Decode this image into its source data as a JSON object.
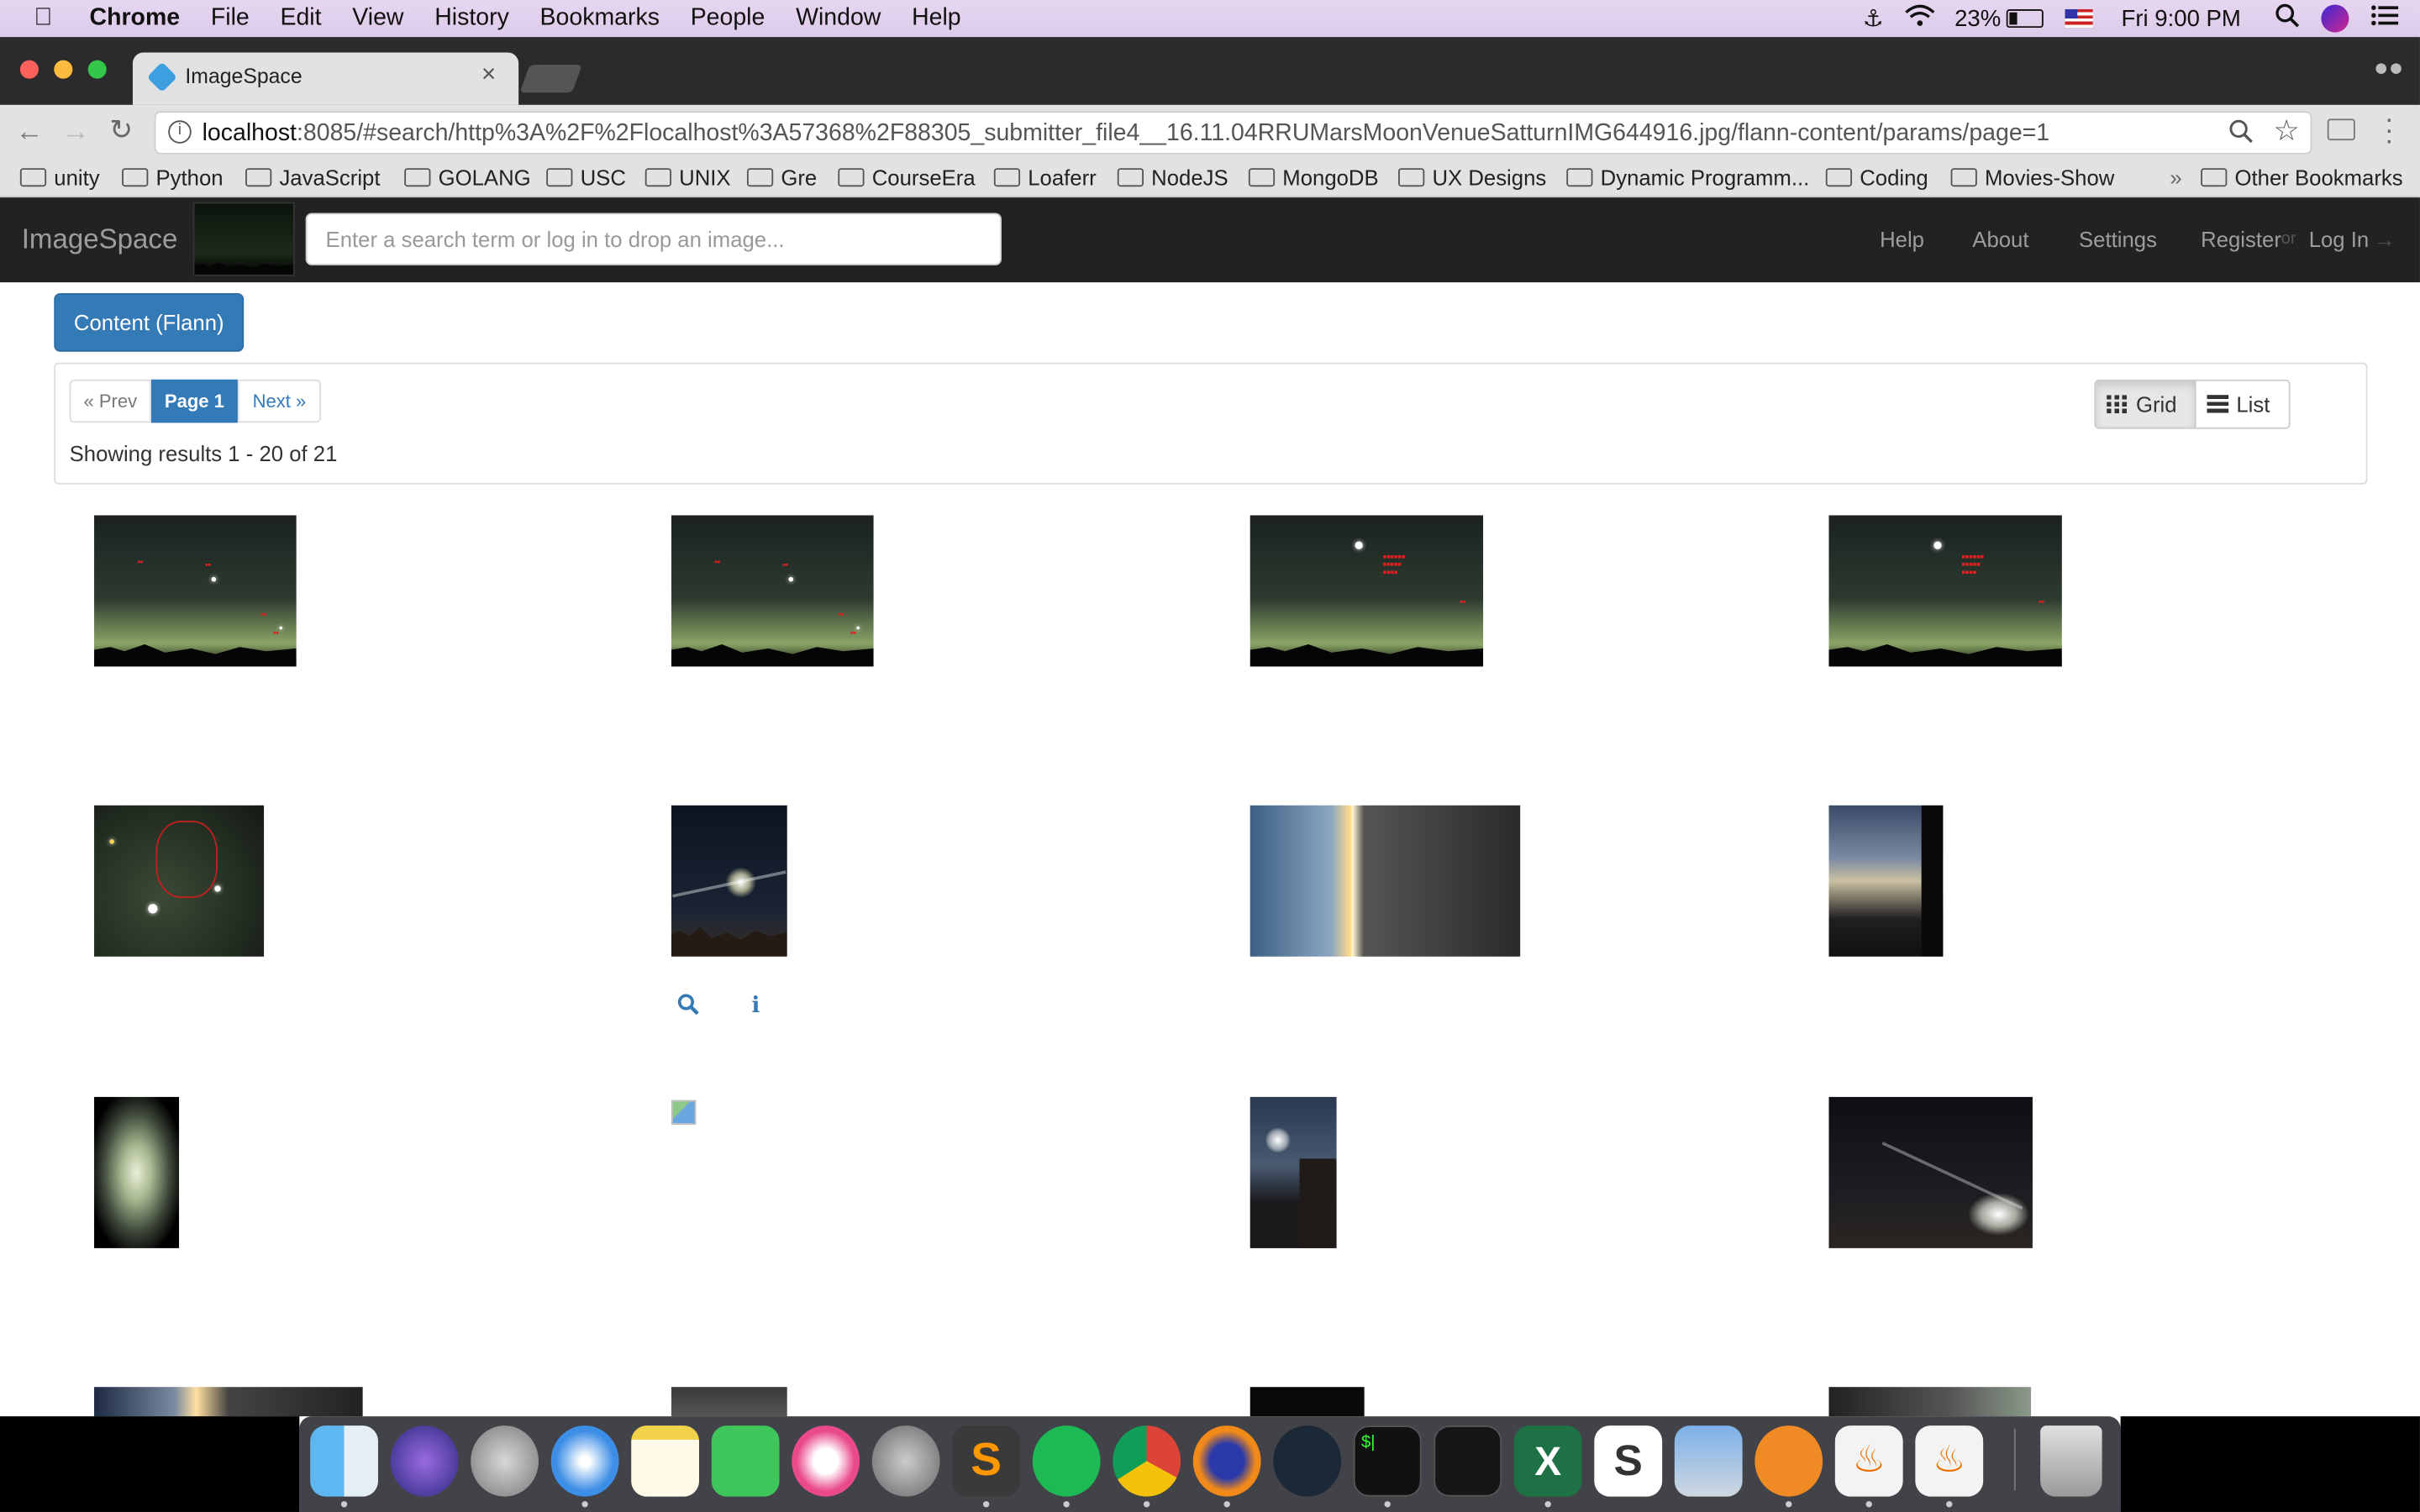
{
  "menubar": {
    "app": "Chrome",
    "items": [
      "File",
      "Edit",
      "View",
      "History",
      "Bookmarks",
      "People",
      "Window",
      "Help"
    ],
    "battery": "23%",
    "clock": "Fri 9:00 PM"
  },
  "browser": {
    "tab_title": "ImageSpace",
    "url_host": "localhost",
    "url_rest": ":8085/#search/http%3A%2F%2Flocalhost%3A57368%2F88305_submitter_file4__16.11.04RRUMarsMoonVenueSatturnIMG644916.jpg/flann-content/params/page=1",
    "bookmarks": [
      "unity",
      "Python",
      "JavaScript",
      "GOLANG",
      "USC",
      "UNIX",
      "Gre",
      "CourseEra",
      "Loaferr",
      "NodeJS",
      "MongoDB",
      "UX Designs",
      "Dynamic Programm...",
      "Coding",
      "Movies-Show"
    ],
    "bookmarks_overflow": "»",
    "other_bookmarks": "Other Bookmarks"
  },
  "app": {
    "brand": "ImageSpace",
    "search_placeholder": "Enter a search term or log in to drop an image...",
    "nav": {
      "help": "Help",
      "about": "About",
      "settings": "Settings",
      "register": "Register",
      "or": "or",
      "login": "Log In"
    },
    "content_button": "Content (Flann)",
    "pagination": {
      "prev": "« Prev",
      "current": "Page 1",
      "next": "Next »"
    },
    "showing": "Showing results 1 - 20 of 21",
    "view": {
      "grid": "Grid",
      "list": "List",
      "active": "grid"
    }
  },
  "results": [
    {
      "kind": "annotated-night-sky"
    },
    {
      "kind": "annotated-night-sky"
    },
    {
      "kind": "annotated-night-sky-2"
    },
    {
      "kind": "annotated-night-sky-2"
    },
    {
      "kind": "star-chart"
    },
    {
      "kind": "street-light-night"
    },
    {
      "kind": "tilted-horizon"
    },
    {
      "kind": "cloudy-sunset"
    },
    {
      "kind": "blurry-orb"
    },
    {
      "kind": "broken-image"
    },
    {
      "kind": "moon-house"
    },
    {
      "kind": "car-headlights"
    },
    {
      "kind": "partial"
    },
    {
      "kind": "partial"
    },
    {
      "kind": "partial"
    },
    {
      "kind": "partial"
    }
  ],
  "dock": [
    "Finder",
    "Siri",
    "Launchpad",
    "Safari",
    "Notes",
    "FaceTime",
    "iTunes",
    "System Preferences",
    "Sublime Text",
    "Spotify",
    "Chrome",
    "Firefox",
    "Steam",
    "Terminal",
    "Activity Monitor",
    "Excel",
    "Slack",
    "Preview",
    "Sketch",
    "Java",
    "Java",
    "Trash"
  ]
}
